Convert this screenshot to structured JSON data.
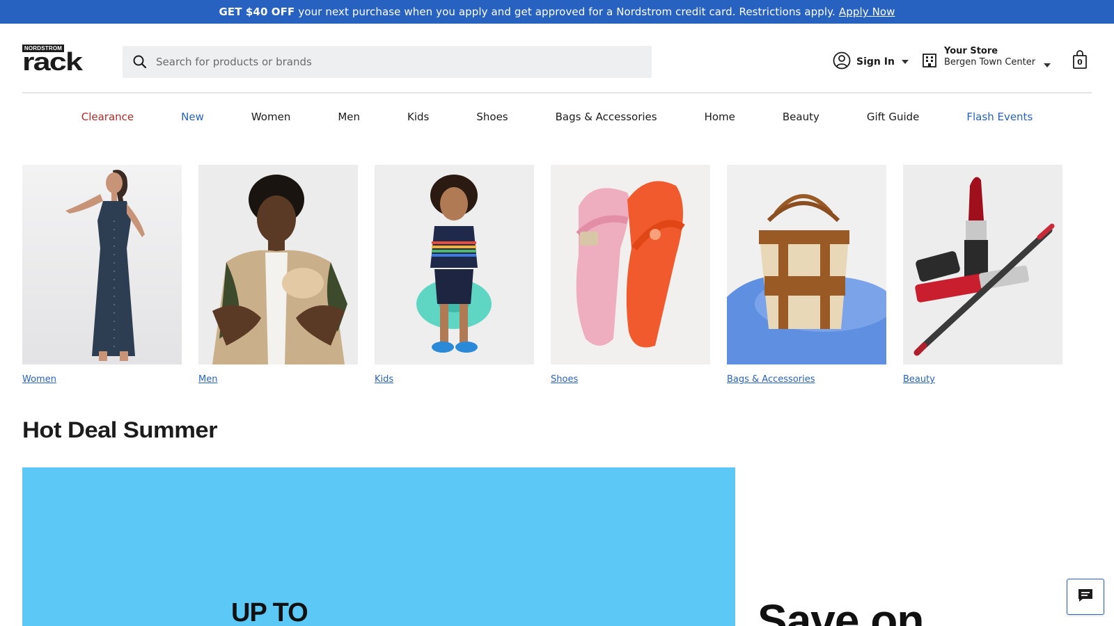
{
  "promo": {
    "bold": "GET $40 OFF",
    "text": "your next purchase when you apply and get approved for a Nordstrom credit card. Restrictions apply.",
    "link": "Apply Now"
  },
  "header": {
    "logo_small": "NORDSTROM",
    "logo_big": "Rack",
    "search_placeholder": "Search for products or brands",
    "signin_label": "Sign In",
    "store_title": "Your Store",
    "store_name": "Bergen Town Center",
    "bag_count": "0"
  },
  "nav": {
    "items": [
      "Clearance",
      "New",
      "Women",
      "Men",
      "Kids",
      "Shoes",
      "Bags & Accessories",
      "Home",
      "Beauty",
      "Gift Guide",
      "Flash Events"
    ]
  },
  "categories": [
    {
      "label": "Women"
    },
    {
      "label": "Men"
    },
    {
      "label": "Kids"
    },
    {
      "label": "Shoes"
    },
    {
      "label": "Bags & Accessories"
    },
    {
      "label": "Beauty"
    }
  ],
  "section": {
    "title": "Hot Deal Summer"
  },
  "hero": {
    "text": "UP TO",
    "side_text": "Save on"
  },
  "colors": {
    "brand_blue": "#2762c0",
    "clearance_red": "#b02a2a",
    "hero_bg": "#5bc8f5"
  },
  "icons": {
    "search": "search-icon",
    "account": "user-circle-icon",
    "store": "store-icon",
    "bag": "shopping-bag-icon",
    "chat": "chat-icon"
  }
}
